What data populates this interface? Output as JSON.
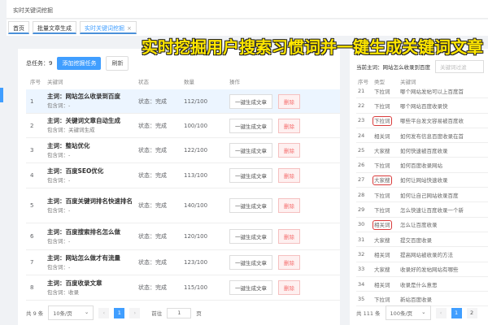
{
  "window_title": "实时关键词挖掘",
  "tabs": [
    {
      "label": "首页"
    },
    {
      "label": "批量文章生成"
    },
    {
      "label": "实时关键词挖掘",
      "close": "×"
    }
  ],
  "headline": "实时挖掘用户搜索习惯词并一键生成关键词文章",
  "left": {
    "total_label": "总任务：9",
    "add_button": "添加挖掘任务",
    "refresh_button": "刷新",
    "columns": [
      "序号",
      "关键词",
      "状态",
      "数量",
      "操作"
    ],
    "rows": [
      {
        "no": "1",
        "main": "主词：网站怎么收录到百度",
        "sub": "包含词：-",
        "status": "状态：完成",
        "count": "112/100"
      },
      {
        "no": "2",
        "main": "主词：关键词文章自动生成",
        "sub": "包含词：关键词生成",
        "status": "状态：完成",
        "count": "100/100"
      },
      {
        "no": "3",
        "main": "主词：整站优化",
        "sub": "包含词：-",
        "status": "状态：完成",
        "count": "122/100"
      },
      {
        "no": "4",
        "main": "主词：百度SEO优化",
        "sub": "包含词：-",
        "status": "状态：完成",
        "count": "113/100"
      },
      {
        "no": "5",
        "main": "主词：百度关键词排名快速排名",
        "sub": "包含词：-",
        "status": "状态：完成",
        "count": "140/100"
      },
      {
        "no": "6",
        "main": "主词：百度搜索排名怎么做",
        "sub": "包含词：-",
        "status": "状态：完成",
        "count": "120/100"
      },
      {
        "no": "7",
        "main": "主词：网站怎么做才有流量",
        "sub": "包含词：-",
        "status": "状态：完成",
        "count": "123/100"
      },
      {
        "no": "8",
        "main": "主词：百度收录文章",
        "sub": "包含词：收录",
        "status": "状态：完成",
        "count": "115/100"
      }
    ],
    "generate_label": "一键生成文章",
    "delete_label": "删除",
    "pagination": {
      "total": "共 9 条",
      "page_size": "10条/页",
      "current": "1",
      "goto_label": "前往",
      "goto_value": "1",
      "page_unit": "页"
    }
  },
  "right": {
    "current_label": "当前主词：网站怎么收录到百度",
    "filter_placeholder": "关键词过滤",
    "columns": [
      "序号",
      "类型",
      "关键词"
    ],
    "rows": [
      {
        "no": "21",
        "type": "下拉词",
        "kw": "哪个网站发帖可以上百度首",
        "boxed": false
      },
      {
        "no": "22",
        "type": "下拉词",
        "kw": "哪个网站百度收录快",
        "boxed": false
      },
      {
        "no": "23",
        "type": "下拉词",
        "kw": "哪些平台发文容易被百度收",
        "boxed": true
      },
      {
        "no": "24",
        "type": "相关词",
        "kw": "如何发布信息百度收录在首",
        "boxed": false
      },
      {
        "no": "25",
        "type": "大家搜",
        "kw": "如何快速被百度收录",
        "boxed": false
      },
      {
        "no": "26",
        "type": "下拉词",
        "kw": "如何百度收录网站",
        "boxed": false
      },
      {
        "no": "27",
        "type": "大家搜",
        "kw": "如何让网站快速收录",
        "boxed": true
      },
      {
        "no": "28",
        "type": "下拉词",
        "kw": "如何让自己网站收录百度",
        "boxed": false
      },
      {
        "no": "29",
        "type": "下拉词",
        "kw": "怎么快速让百度收录一个新",
        "boxed": false
      },
      {
        "no": "30",
        "type": "相关词",
        "kw": "怎么让百度收录",
        "boxed": true
      },
      {
        "no": "31",
        "type": "大家搜",
        "kw": "提交百度收录",
        "boxed": false
      },
      {
        "no": "32",
        "type": "相关词",
        "kw": "提高网站被收录的方法",
        "boxed": false
      },
      {
        "no": "33",
        "type": "大家搜",
        "kw": "收录好的发帖网站有哪些",
        "boxed": false
      },
      {
        "no": "34",
        "type": "相关词",
        "kw": "收录是什么意思",
        "boxed": false
      },
      {
        "no": "35",
        "type": "下拉词",
        "kw": "新站百度收录",
        "boxed": false
      }
    ],
    "pagination": {
      "total": "共 111 条",
      "page_size": "100条/页",
      "pages": [
        "1",
        "2"
      ]
    }
  },
  "colors": {
    "accent": "#409eff",
    "danger": "#f56c6c",
    "highlight_box": "#d93b3b",
    "headline": "#ffe600"
  }
}
